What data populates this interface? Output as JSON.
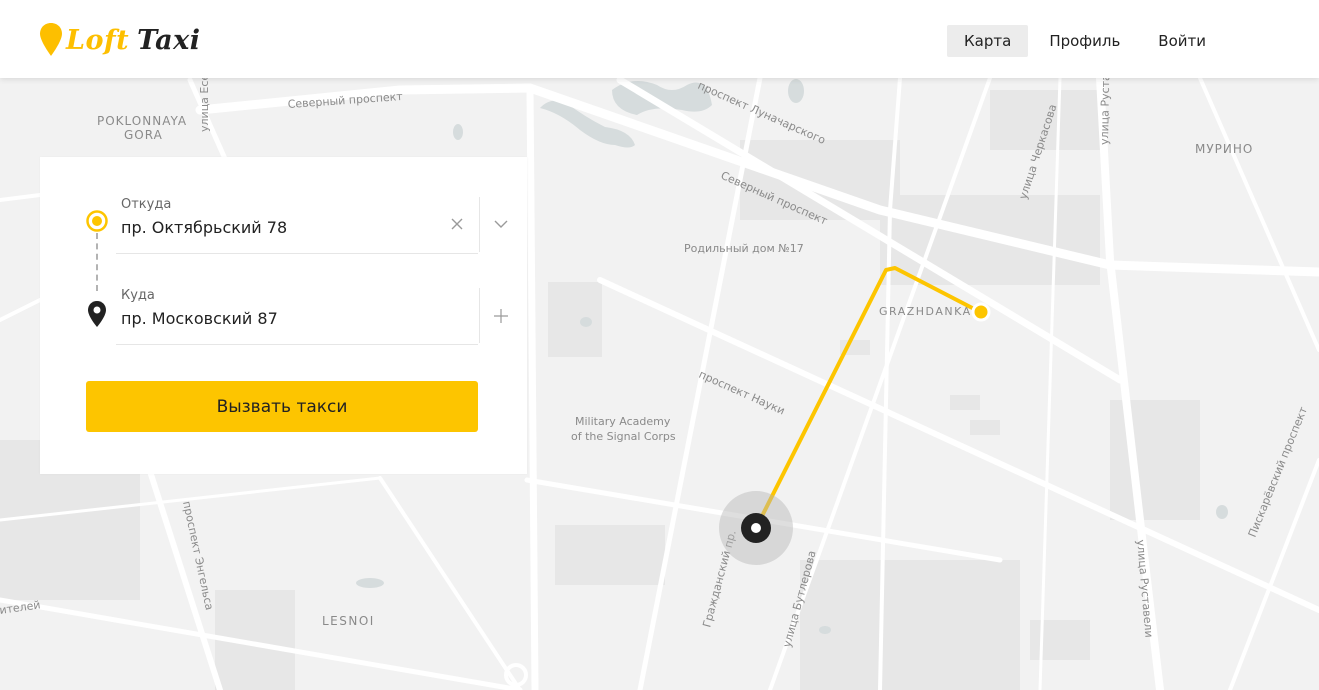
{
  "header": {
    "logo_first": "Loft",
    "logo_second": "Taxi",
    "nav": [
      {
        "label": "Карта",
        "active": true
      },
      {
        "label": "Профиль",
        "active": false
      },
      {
        "label": "Войти",
        "active": false
      }
    ]
  },
  "order_form": {
    "from": {
      "label": "Откуда",
      "value": "пр. Октябрьский 78",
      "clear_icon": "close-icon",
      "toggle_icon": "chevron-down-icon"
    },
    "to": {
      "label": "Куда",
      "value": "пр. Московский 87",
      "add_icon": "plus-icon"
    },
    "submit_label": "Вызвать такси"
  },
  "map": {
    "districts": [
      "POKLONNAYA",
      "GORA",
      "МУРИНО",
      "GRAZHDANKA",
      "LESNOI"
    ],
    "streets": [
      "Северный проспект",
      "проспект Луначарского",
      "Северный проспект",
      "улица Есенина",
      "улица Черкасова",
      "улица Руставели",
      "проспект Науки",
      "Гражданский пр.",
      "улица Бутлерова",
      "улица Руставели",
      "Пискарёвский проспект",
      "проспект Энгельса",
      "ителей"
    ],
    "pois": [
      "Родильный дом №17",
      "Military Academy",
      "of the Signal Corps"
    ],
    "route_color": "#fdc500",
    "marker_color": "#222222"
  }
}
